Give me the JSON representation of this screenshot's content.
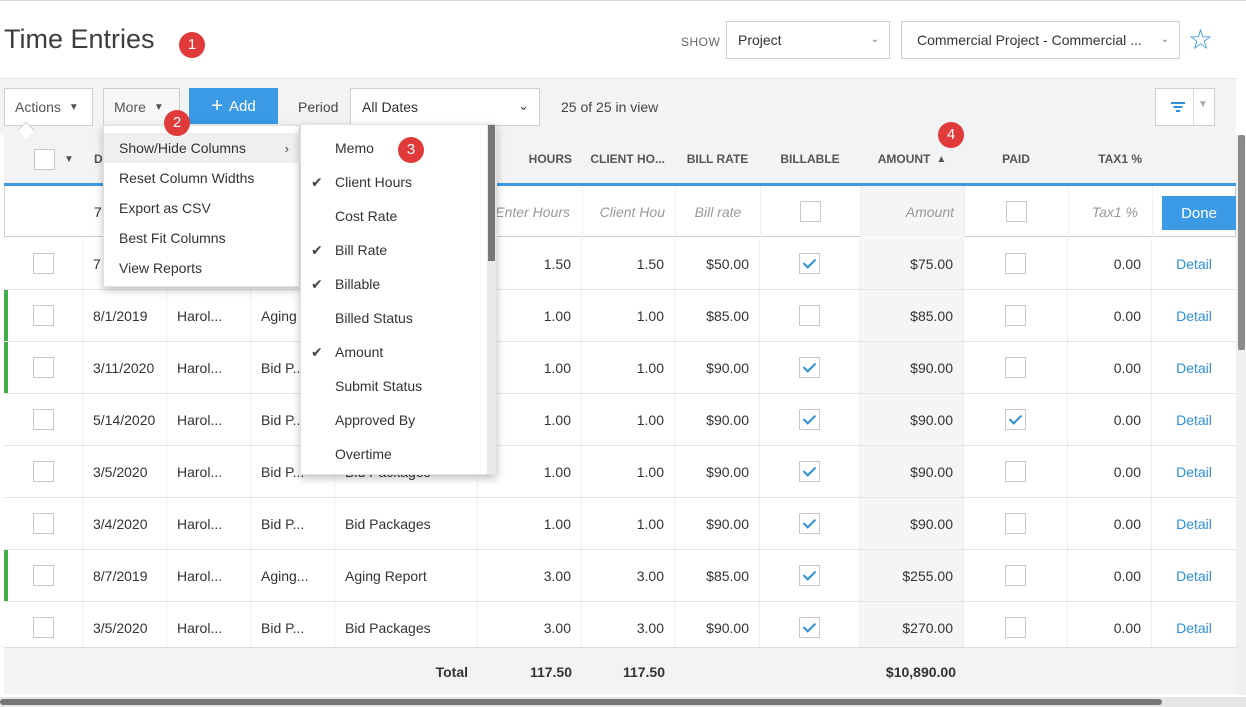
{
  "header": {
    "title": "Time Entries",
    "show_label": "SHOW",
    "show_value": "Project",
    "project_value": "Commercial Project - Commercial ..."
  },
  "badges": [
    "1",
    "2",
    "3",
    "4"
  ],
  "toolbar": {
    "actions_label": "Actions",
    "more_label": "More",
    "add_label": "Add",
    "period_label": "Period",
    "period_value": "All Dates",
    "in_view": "25 of 25 in view"
  },
  "more_menu": {
    "items": [
      "Show/Hide Columns",
      "Reset Column Widths",
      "Export as CSV",
      "Best Fit Columns",
      "View Reports"
    ]
  },
  "columns_menu": {
    "items": [
      {
        "label": "Memo",
        "checked": false
      },
      {
        "label": "Client Hours",
        "checked": true
      },
      {
        "label": "Cost Rate",
        "checked": false
      },
      {
        "label": "Bill Rate",
        "checked": true
      },
      {
        "label": "Billable",
        "checked": true
      },
      {
        "label": "Billed Status",
        "checked": false
      },
      {
        "label": "Amount",
        "checked": true
      },
      {
        "label": "Submit Status",
        "checked": false
      },
      {
        "label": "Approved By",
        "checked": false
      },
      {
        "label": "Overtime",
        "checked": false
      }
    ]
  },
  "table": {
    "headers": {
      "date": "D",
      "hours": "HOURS",
      "client_hours": "CLIENT HO...",
      "bill_rate": "BILL RATE",
      "billable": "BILLABLE",
      "amount": "AMOUNT",
      "paid": "PAID",
      "tax1": "TAX1 %"
    },
    "edit_row": {
      "date": "7",
      "hours_placeholder": "Enter Hours",
      "client_hours_placeholder": "Client Hou",
      "bill_rate_placeholder": "Bill rate",
      "amount_placeholder": "Amount",
      "tax_placeholder": "Tax1 %",
      "done_label": "Done"
    },
    "rows": [
      {
        "date": "7",
        "person": "",
        "task": "",
        "memo": "",
        "hours": "1.50",
        "client_hours": "1.50",
        "bill_rate": "$50.00",
        "billable": true,
        "amount": "$75.00",
        "paid": false,
        "tax": "0.00",
        "detail": "Detail",
        "flag": false
      },
      {
        "date": "8/1/2019",
        "person": "Harol...",
        "task": "Aging",
        "memo": "",
        "hours": "1.00",
        "client_hours": "1.00",
        "bill_rate": "$85.00",
        "billable": false,
        "amount": "$85.00",
        "paid": false,
        "tax": "0.00",
        "detail": "Detail",
        "flag": true
      },
      {
        "date": "3/11/2020",
        "person": "Harol...",
        "task": "Bid P...",
        "memo": "",
        "hours": "1.00",
        "client_hours": "1.00",
        "bill_rate": "$90.00",
        "billable": true,
        "amount": "$90.00",
        "paid": false,
        "tax": "0.00",
        "detail": "Detail",
        "flag": true
      },
      {
        "date": "5/14/2020",
        "person": "Harol...",
        "task": "Bid P...",
        "memo": "",
        "hours": "1.00",
        "client_hours": "1.00",
        "bill_rate": "$90.00",
        "billable": true,
        "amount": "$90.00",
        "paid": true,
        "tax": "0.00",
        "detail": "Detail",
        "flag": false
      },
      {
        "date": "3/5/2020",
        "person": "Harol...",
        "task": "Bid P...",
        "memo": "Bid Packages",
        "hours": "1.00",
        "client_hours": "1.00",
        "bill_rate": "$90.00",
        "billable": true,
        "amount": "$90.00",
        "paid": false,
        "tax": "0.00",
        "detail": "Detail",
        "flag": false
      },
      {
        "date": "3/4/2020",
        "person": "Harol...",
        "task": "Bid P...",
        "memo": "Bid Packages",
        "hours": "1.00",
        "client_hours": "1.00",
        "bill_rate": "$90.00",
        "billable": true,
        "amount": "$90.00",
        "paid": false,
        "tax": "0.00",
        "detail": "Detail",
        "flag": false
      },
      {
        "date": "8/7/2019",
        "person": "Harol...",
        "task": "Aging...",
        "memo": "Aging Report",
        "hours": "3.00",
        "client_hours": "3.00",
        "bill_rate": "$85.00",
        "billable": true,
        "amount": "$255.00",
        "paid": false,
        "tax": "0.00",
        "detail": "Detail",
        "flag": true
      },
      {
        "date": "3/5/2020",
        "person": "Harol...",
        "task": "Bid P...",
        "memo": "Bid Packages",
        "hours": "3.00",
        "client_hours": "3.00",
        "bill_rate": "$90.00",
        "billable": true,
        "amount": "$270.00",
        "paid": false,
        "tax": "0.00",
        "detail": "Detail",
        "flag": false
      }
    ],
    "totals": {
      "label": "Total",
      "hours": "117.50",
      "client_hours": "117.50",
      "amount": "$10,890.00"
    }
  },
  "colors": {
    "accent": "#3a9ae6",
    "flag_green": "#3fae49",
    "badge_red": "#e03a3a"
  }
}
